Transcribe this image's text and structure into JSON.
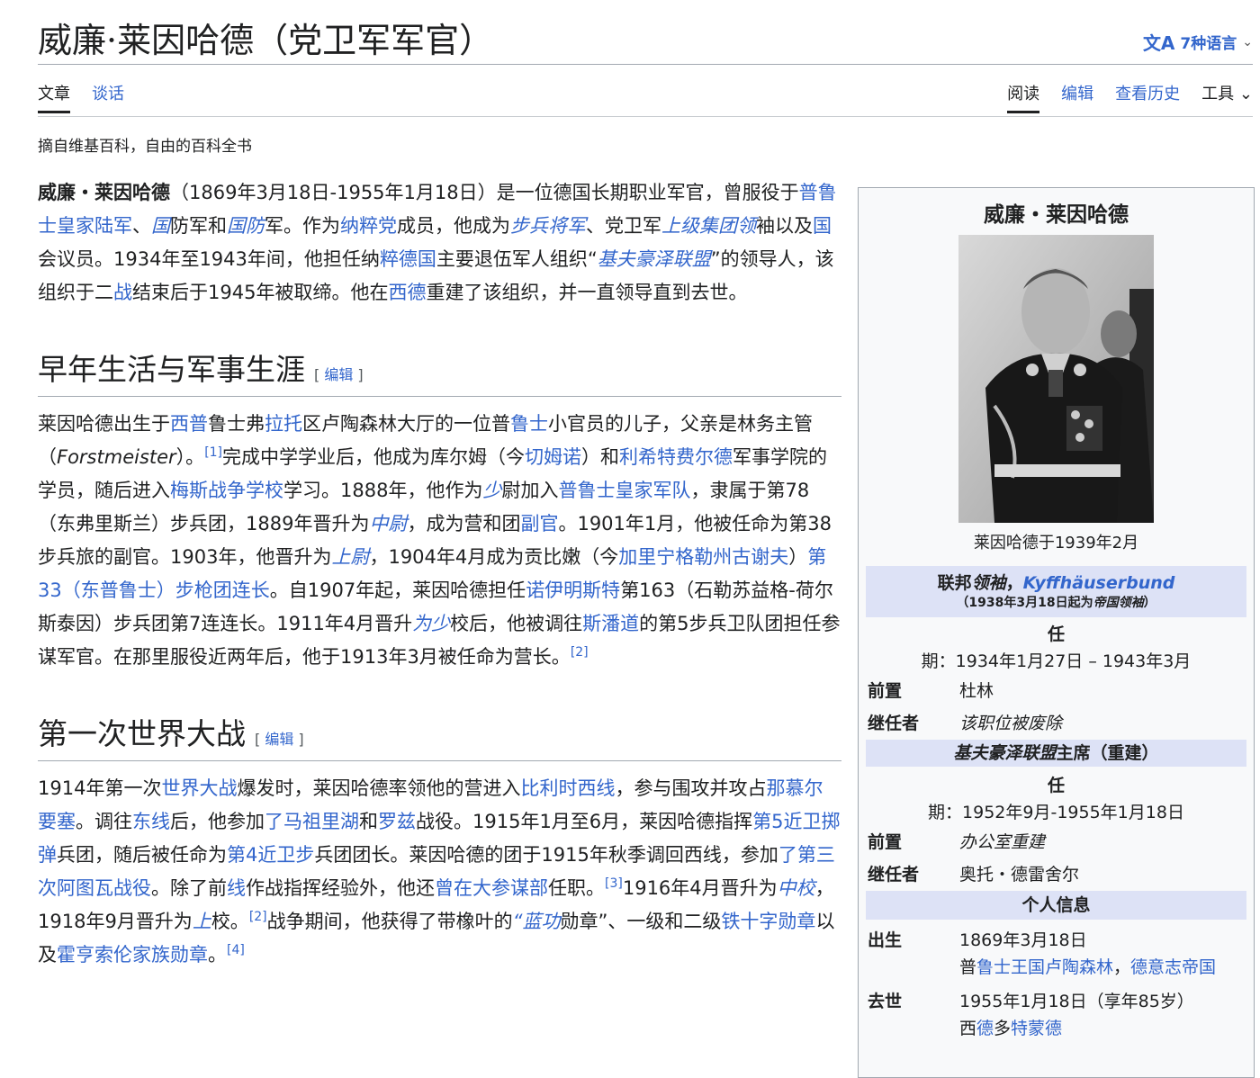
{
  "header": {
    "title": "威廉·莱因哈德（党卫军军官）",
    "languages_label": "7种语言",
    "lang_icon": "文A",
    "chevron": "⌄"
  },
  "tabs": {
    "article": "文章",
    "talk": "谈话",
    "read": "阅读",
    "edit": "编辑",
    "history": "查看历史",
    "tools": "工具"
  },
  "tagline": "摘自维基百科，自由的百科全书",
  "sections": {
    "early_life": "早年生活与军事生涯",
    "ww1": "第一次世界大战",
    "edit_label": "编辑"
  },
  "infobox": {
    "title": "威廉・莱因哈德",
    "photo_caption": "莱因哈德于1939年2月",
    "band1_line1_a": "联邦",
    "band1_line1_b": "领袖",
    "band1_line1_c": "，",
    "band1_line1_link": "Kyffhäuserbund",
    "band1_line2_a": "（1938年3月18日起为",
    "band1_line2_b": "帝国领袖",
    "band1_line2_c": "）",
    "term1_label": "任",
    "term1_value": "期：1934年1月27日 – 1943年3月",
    "predecessor_label": "前置",
    "predecessor1": "杜林",
    "successor_label": "继任者",
    "successor1": "该职位被废除",
    "band2_a": "基夫豪泽联盟",
    "band2_b": "主席（重建）",
    "term2_label": "任",
    "term2_value": "期：1952年9月-1955年1月18日",
    "predecessor2": "办公室重建",
    "successor2": "奥托・德雷舍尔",
    "personal_band": "个人信息",
    "born_label": "出生",
    "born_date": "1869年3月18日",
    "born_place_a": "普",
    "born_place_link1": "鲁士王国卢陶森林",
    "born_place_sep": "，",
    "born_place_link2": "德意志帝国",
    "died_label": "去世",
    "died_date": "1955年1月18日（享年85岁）",
    "died_place_a": "西",
    "died_place_link1": "德",
    "died_place_b": "多",
    "died_place_link2": "特蒙德"
  }
}
